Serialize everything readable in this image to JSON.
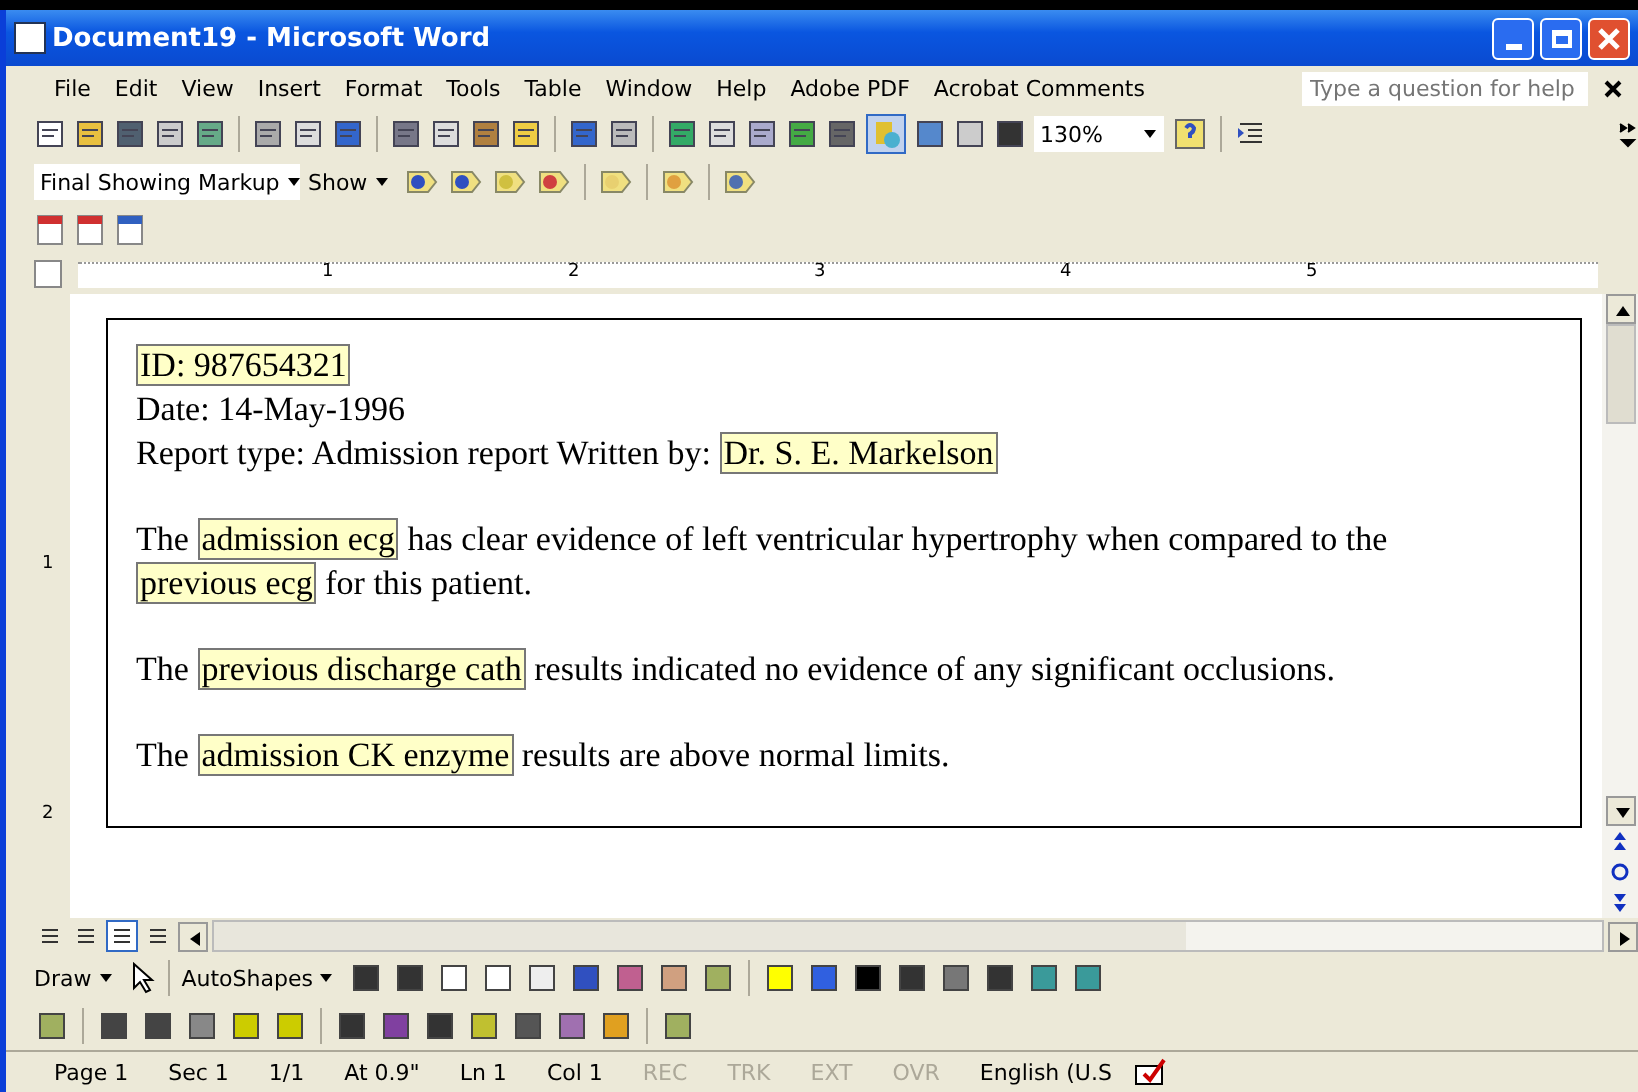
{
  "window": {
    "title": "Document19 - Microsoft Word"
  },
  "menu": [
    "File",
    "Edit",
    "View",
    "Insert",
    "Format",
    "Tools",
    "Table",
    "Window",
    "Help",
    "Adobe PDF",
    "Acrobat Comments"
  ],
  "help_box": {
    "placeholder": "Type a question for help"
  },
  "standard_toolbar": {
    "zoom": "130%",
    "toggles": [
      {
        "selected": true
      }
    ]
  },
  "reviewing_toolbar": {
    "display": "Final Showing Markup",
    "show": "Show"
  },
  "ruler": {
    "numbers": [
      "1",
      "2",
      "3",
      "4",
      "5"
    ],
    "vertical_numbers": [
      "1",
      "2"
    ]
  },
  "document": {
    "paragraphs": [
      [
        {
          "text": "ID: 987654321",
          "tagged": true
        }
      ],
      [
        {
          "text": "Date: 14-May-1996",
          "tagged": false
        }
      ],
      [
        {
          "text": "Report type: Admission report Written by: ",
          "tagged": false
        },
        {
          "text": "Dr. S. E. Markelson",
          "tagged": true
        }
      ],
      [
        {
          "text": "The ",
          "tagged": false
        },
        {
          "text": "admission ecg",
          "tagged": true
        },
        {
          "text": " has clear evidence of left ventricular hypertrophy when compared to the ",
          "tagged": false
        },
        {
          "text": "previous ecg",
          "tagged": true
        },
        {
          "text": " for this patient.",
          "tagged": false
        }
      ],
      [
        {
          "text": "The ",
          "tagged": false
        },
        {
          "text": "previous discharge cath",
          "tagged": true
        },
        {
          "text": " results indicated no evidence of any significant occlusions.",
          "tagged": false
        }
      ],
      [
        {
          "text": "The ",
          "tagged": false
        },
        {
          "text": "admission CK enzyme",
          "tagged": true
        },
        {
          "text": " results are above normal limits.",
          "tagged": false
        }
      ]
    ]
  },
  "views": [
    {
      "selected": false
    },
    {
      "selected": false
    },
    {
      "selected": true
    },
    {
      "selected": false
    }
  ],
  "drawing_toolbar": {
    "draw": "Draw",
    "autoshapes": "AutoShapes"
  },
  "status_bar": [
    {
      "text": "Page 1",
      "disabled": false
    },
    {
      "text": "Sec 1",
      "disabled": false
    },
    {
      "text": "1/1",
      "disabled": false
    },
    {
      "text": "At 0.9\"",
      "disabled": false
    },
    {
      "text": "Ln 1",
      "disabled": false
    },
    {
      "text": "Col 1",
      "disabled": false
    },
    {
      "text": "REC",
      "disabled": true
    },
    {
      "text": "TRK",
      "disabled": true
    },
    {
      "text": "EXT",
      "disabled": true
    },
    {
      "text": "OVR",
      "disabled": true
    },
    {
      "text": "English (U.S",
      "disabled": false
    }
  ]
}
